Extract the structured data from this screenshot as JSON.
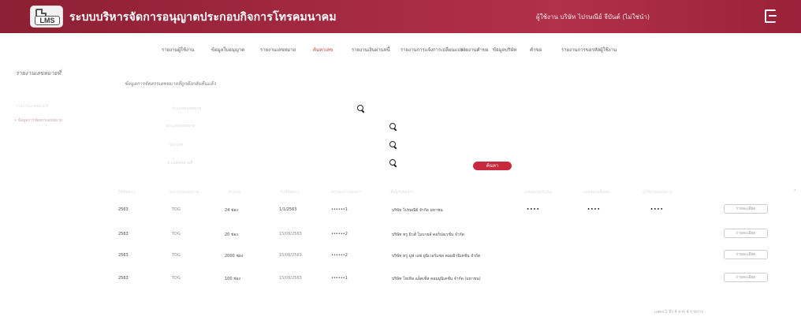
{
  "header": {
    "title": "ระบบบริหารจัดการอนุญาตประกอบกิจการโทรคมนาคม",
    "user_info": "ผู้ใช้งาน บริษัท ไปรษณีย์ จีบันต์ (ไม่ใช่นำ)",
    "logo_text": "LMS"
  },
  "topnav": {
    "items": [
      {
        "label": "รายงานผู้ใช้งาน"
      },
      {
        "label": "ข้อมูลใบอนุญาต"
      },
      {
        "label": "รายงานเลขหมาย"
      },
      {
        "label": "ค้นหาเลข"
      },
      {
        "label": "รายงานเงินผ่านหนี้"
      },
      {
        "label": "รายงานการแจ้งการเปลี่ยนแปลง"
      },
      {
        "label": "รายงานคำขอ"
      },
      {
        "label": "ข้อมูลบริษัท"
      },
      {
        "label": "คำขอ"
      },
      {
        "label": "รายงานการขอรหัสผู้ใช้งาน"
      }
    ]
  },
  "sidebar": {
    "title": "รายงานเลขหมายที่",
    "faint_item": "รายงานเลขหมายที่",
    "active_item": "• ข้อมูลการจัดสรรเลขหมาย"
  },
  "search_form": {
    "title": "ข้อมูลการจัดสรรเลขหมายที่ถูกดึงกลับคืนแล้ว",
    "labels": [
      "ประเภทเลขหมาย",
      "ประเภทเลขหมาย",
      "ประเภท",
      "ช่วงเลขหมายที่"
    ],
    "button_label": "ค้นหา"
  },
  "table": {
    "headers": [
      "ปีที่จัดสรร",
      "ประเภทเลขหมาย",
      "จำนวน",
      "วันที่จัดสรร",
      "สถานะการจัดสรร",
      "ชื่อผู้รับจัดสรร",
      "เลขหมายเริ่มต้น",
      "เลขหมายสิ้นสุด",
      "ผู้ใช้งานเลขหมาย"
    ],
    "rows": [
      {
        "year": "2563",
        "type": "TOG",
        "amount": "24 ช่อง",
        "date": "1/1/2563",
        "status": "••••••1",
        "name": "บริษัท ไปรษณีย์ จำกัด มหาชน",
        "a": "••••",
        "b": "••••",
        "c": "••••",
        "btn": "รายละเอียด"
      },
      {
        "year": "2563",
        "type": "TOG",
        "amount": "20 ช่อง",
        "date": "15/06/2563",
        "status": "••••••2",
        "name": "บริษัท ทรู มิวส์ โมบายล์ คอร์ปอเรชั่น จำกัด",
        "btn": "รายละเอียด"
      },
      {
        "year": "2563",
        "type": "TOG",
        "amount": "2000 ช่อง",
        "date": "15/06/2563",
        "status": "••••••2",
        "name": "บริษัท ทรู มูฟ เอช ยูนิเวอร์แซล คอมมิวนิเคชั่น จำกัด",
        "btn": "รายละเอียด"
      },
      {
        "year": "2563",
        "type": "TOG",
        "amount": "100 ช่อง",
        "date": "15/06/2563",
        "status": "••••••1",
        "name": "บริษัท โทเทิ่ล แอ็คเซ็ส คอมมูนิเคชั่น จำกัด (มหาชน)",
        "btn": "รายละเอียด"
      }
    ]
  },
  "pagination": {
    "text": "แสดง 1 ถึง 4 จาก 4 รายการ"
  },
  "colors": {
    "header_bg": "#a52a42",
    "accent": "#c72a3c"
  }
}
